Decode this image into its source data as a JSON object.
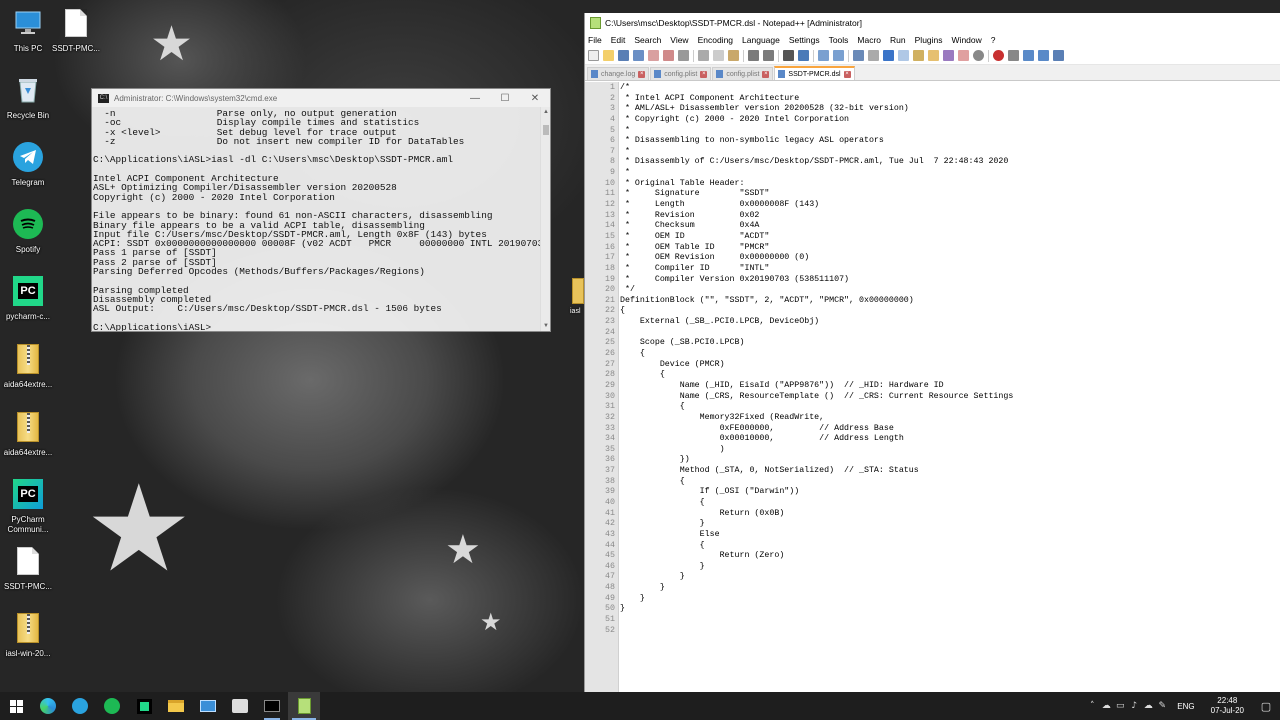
{
  "desktop": {
    "icons": [
      {
        "label": "This PC"
      },
      {
        "label": "SSDT-PMC..."
      },
      {
        "label": "Recycle Bin"
      },
      {
        "label": "Telegram"
      },
      {
        "label": "Spotify"
      },
      {
        "label": "pycharm-c..."
      },
      {
        "label": "aida64extre..."
      },
      {
        "label": "aida64extre..."
      },
      {
        "label": "PyCharm Communi..."
      },
      {
        "label": "SSDT-PMC..."
      },
      {
        "label": "iasl-win-20..."
      }
    ],
    "partial_icon_label": "iasl"
  },
  "cmd": {
    "title": "Administrator: C:\\Windows\\system32\\cmd.exe",
    "icon_text": "C:\\",
    "lines": [
      "  -n                  Parse only, no output generation",
      "  -oc                 Display compile times and statistics",
      "  -x <level>          Set debug level for trace output",
      "  -z                  Do not insert new compiler ID for DataTables",
      "",
      "C:\\Applications\\iASL>iasl -dl C:\\Users\\msc\\Desktop\\SSDT-PMCR.aml",
      "",
      "Intel ACPI Component Architecture",
      "ASL+ Optimizing Compiler/Disassembler version 20200528",
      "Copyright (c) 2000 - 2020 Intel Corporation",
      "",
      "File appears to be binary: found 61 non-ASCII characters, disassembling",
      "Binary file appears to be a valid ACPI table, disassembling",
      "Input file C:/Users/msc/Desktop/SSDT-PMCR.aml, Length 0x8F (143) bytes",
      "ACPI: SSDT 0x0000000000000000 00008F (v02 ACDT   PMCR     00000000 INTL 20190703)",
      "Pass 1 parse of [SSDT]",
      "Pass 2 parse of [SSDT]",
      "Parsing Deferred Opcodes (Methods/Buffers/Packages/Regions)",
      "",
      "Parsing completed",
      "Disassembly completed",
      "ASL Output:    C:/Users/msc/Desktop/SSDT-PMCR.dsl - 1506 bytes",
      "",
      "C:\\Applications\\iASL>"
    ]
  },
  "npp": {
    "title": "C:\\Users\\msc\\Desktop\\SSDT-PMCR.dsl - Notepad++ [Administrator]",
    "menu": [
      "File",
      "Edit",
      "Search",
      "View",
      "Encoding",
      "Language",
      "Settings",
      "Tools",
      "Macro",
      "Run",
      "Plugins",
      "Window",
      "?"
    ],
    "tabs": [
      {
        "label": "change.log",
        "active": false
      },
      {
        "label": "config.plist",
        "active": false
      },
      {
        "label": "config.plist",
        "active": false
      },
      {
        "label": "SSDT-PMCR.dsl",
        "active": true
      }
    ],
    "code": [
      "/*",
      " * Intel ACPI Component Architecture",
      " * AML/ASL+ Disassembler version 20200528 (32-bit version)",
      " * Copyright (c) 2000 - 2020 Intel Corporation",
      " *",
      " * Disassembling to non-symbolic legacy ASL operators",
      " *",
      " * Disassembly of C:/Users/msc/Desktop/SSDT-PMCR.aml, Tue Jul  7 22:48:43 2020",
      " *",
      " * Original Table Header:",
      " *     Signature        \"SSDT\"",
      " *     Length           0x0000008F (143)",
      " *     Revision         0x02",
      " *     Checksum         0x4A",
      " *     OEM ID           \"ACDT\"",
      " *     OEM Table ID     \"PMCR\"",
      " *     OEM Revision     0x00000000 (0)",
      " *     Compiler ID      \"INTL\"",
      " *     Compiler Version 0x20190703 (538511107)",
      " */",
      "DefinitionBlock (\"\", \"SSDT\", 2, \"ACDT\", \"PMCR\", 0x00000000)",
      "{",
      "    External (_SB_.PCI0.LPCB, DeviceObj)",
      "",
      "    Scope (_SB.PCI0.LPCB)",
      "    {",
      "        Device (PMCR)",
      "        {",
      "            Name (_HID, EisaId (\"APP9876\"))  // _HID: Hardware ID",
      "            Name (_CRS, ResourceTemplate ()  // _CRS: Current Resource Settings",
      "            {",
      "                Memory32Fixed (ReadWrite,",
      "                    0xFE000000,         // Address Base",
      "                    0x00010000,         // Address Length",
      "                    )",
      "            })",
      "            Method (_STA, 0, NotSerialized)  // _STA: Status",
      "            {",
      "                If (_OSI (\"Darwin\"))",
      "                {",
      "                    Return (0x0B)",
      "                }",
      "                Else",
      "                {",
      "                    Return (Zero)",
      "                }",
      "            }",
      "        }",
      "    }",
      "}",
      "",
      ""
    ]
  },
  "taskbar": {
    "language": "ENG",
    "time": "22:48",
    "date": "07-Jul-20"
  }
}
